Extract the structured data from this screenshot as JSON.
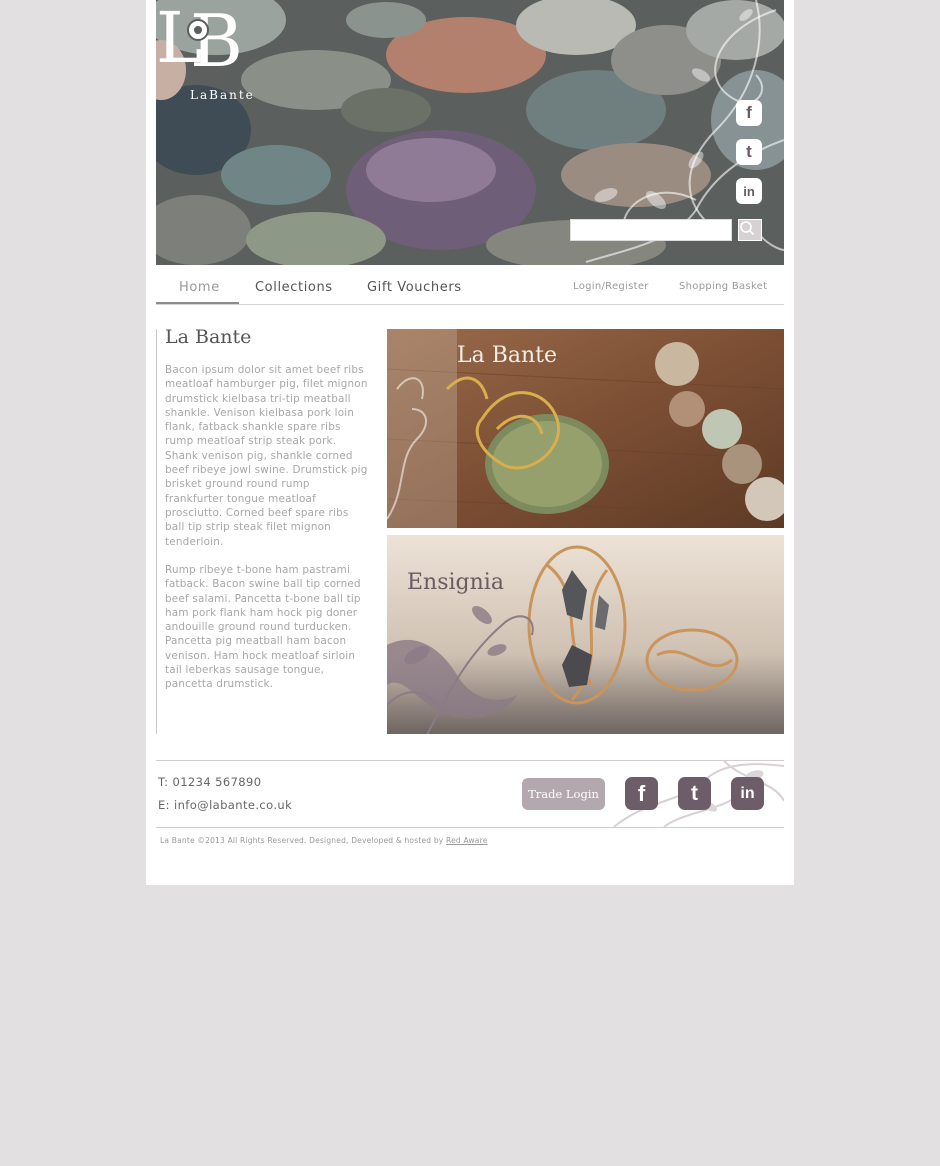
{
  "colors": {
    "page_bg": "#e3e0e1",
    "accent": "#6d5d68",
    "trade_login_bg": "#b3a8ae"
  },
  "header": {
    "logo_monogram": "LB",
    "logo_text": "LaBante",
    "social_icons": [
      "facebook-icon",
      "twitter-icon",
      "linkedin-icon"
    ],
    "social_letters": [
      "f",
      "t",
      "in"
    ],
    "search_placeholder": "",
    "search_icon": "search-icon"
  },
  "nav": {
    "items": [
      {
        "label": "Home"
      },
      {
        "label": "Collections"
      },
      {
        "label": "Gift Vouchers"
      }
    ],
    "login": "Login/Register",
    "basket": "Shopping Basket"
  },
  "main": {
    "title": "La Bante",
    "paragraphs": [
      "Bacon ipsum dolor sit amet beef ribs meatloaf hamburger pig, filet mignon drumstick kielbasa tri-tip meatball shankle. Venison kielbasa pork loin flank, fatback shankle spare ribs rump meatloaf strip steak pork. Shank venison pig, shankle corned beef ribeye jowl swine. Drumstick pig brisket ground round rump frankfurter tongue meatloaf prosciutto. Corned beef spare ribs ball tip strip steak filet mignon tenderloin.",
      "Rump ribeye t-bone ham pastrami fatback. Bacon swine ball tip corned beef salami. Pancetta t-bone ball tip ham pork flank ham hock pig doner andouille ground round turducken. Pancetta pig meatball ham bacon venison. Ham hock meatloaf sirloin tail leberkas sausage tongue, pancetta drumstick."
    ],
    "promos": [
      {
        "title": "La Bante"
      },
      {
        "title": "Ensignia"
      }
    ]
  },
  "footer": {
    "phone": "T: 01234 567890",
    "email": "E: info@labante.co.uk",
    "trade_login": "Trade Login",
    "social_letters": [
      "f",
      "t",
      "in"
    ],
    "copyright_text": "La Bante ©2013 All Rights Reserved. Designed, Developed & hosted by",
    "copyright_link": "Red Aware"
  }
}
